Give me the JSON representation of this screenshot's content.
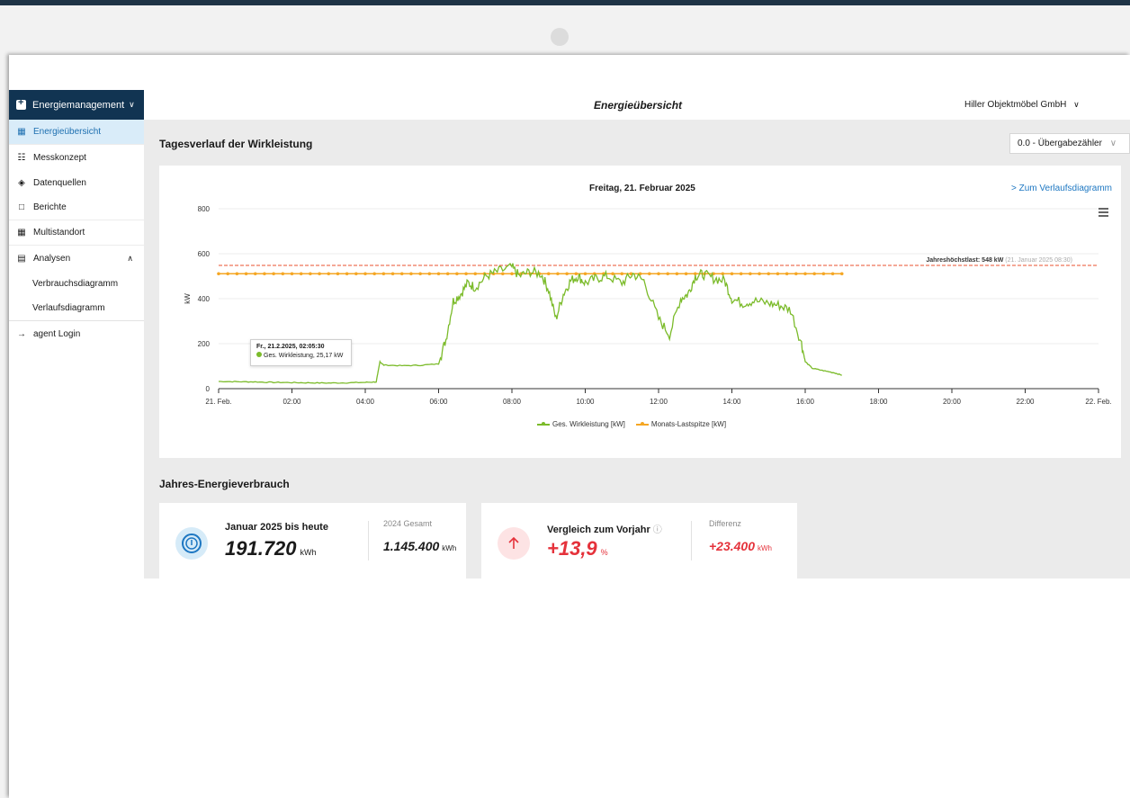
{
  "app": {
    "page_title": "Energieübersicht",
    "company": "Hiller Objektmöbel GmbH"
  },
  "sidebar": {
    "header": "Energiemanagement",
    "items": [
      {
        "label": "Energieübersicht",
        "icon": "dashboard-icon",
        "active": true
      },
      {
        "label": "Messkonzept",
        "icon": "hierarchy-icon"
      },
      {
        "label": "Datenquellen",
        "icon": "datasource-icon"
      },
      {
        "label": "Berichte",
        "icon": "document-icon"
      },
      {
        "label": "Multistandort",
        "icon": "buildings-icon"
      },
      {
        "label": "Analysen",
        "icon": "chart-icon"
      },
      {
        "label": "Verbrauchsdiagramm",
        "icon": ""
      },
      {
        "label": "Verlaufsdiagramm",
        "icon": ""
      },
      {
        "label": "agent Login",
        "icon": "arrow-right-icon"
      }
    ]
  },
  "main": {
    "section1_title": "Tagesverlauf der Wirkleistung",
    "meter_select": "0.0 - Übergabezähler",
    "chart_link": "Zum Verlaufsdiagramm",
    "tooltip": {
      "title": "Fr., 21.2.2025, 02:05:30",
      "line": "Ges. Wirkleistung, 25,17 kW"
    },
    "annotation": {
      "label": "Jahreshöchstlast: 548 kW",
      "detail": "(21. Januar 2025 08:30)"
    },
    "section2_title": "Jahres-Energieverbrauch",
    "card1": {
      "label": "Januar 2025 bis heute",
      "value": "191.720",
      "unit": "kWh",
      "sub_label": "2024 Gesamt",
      "sub_value": "1.145.400",
      "sub_unit": "kWh"
    },
    "card2": {
      "label": "Vergleich zum Vorjahr",
      "value": "+13,9",
      "unit": "%",
      "sub_label": "Differenz",
      "sub_value": "+23.400",
      "sub_unit": "kWh"
    }
  },
  "colors": {
    "primary_dark": "#113452",
    "accent_blue": "#1d77c2",
    "series_green": "#7bbb2a",
    "series_orange": "#f5a623",
    "annual_peak_red": "#e8502f",
    "negative_red": "#e5323b"
  },
  "chart_data": {
    "type": "line",
    "title": "Freitag, 21. Februar 2025",
    "ylabel": "kW",
    "ylim": [
      0,
      800
    ],
    "yticks": [
      0,
      200,
      400,
      600,
      800
    ],
    "xticks": [
      "21. Feb.",
      "02:00",
      "04:00",
      "06:00",
      "08:00",
      "10:00",
      "12:00",
      "14:00",
      "16:00",
      "18:00",
      "20:00",
      "22:00",
      "22. Feb."
    ],
    "xlim_hours": [
      0,
      24
    ],
    "series": [
      {
        "name": "Ges. Wirkleistung [kW]",
        "x_hours": [
          0,
          0.5,
          1,
          1.5,
          2,
          2.5,
          3,
          3.5,
          4,
          4.3,
          4.4,
          4.5,
          5,
          5.5,
          6,
          6.2,
          6.4,
          6.6,
          6.8,
          7,
          7.3,
          7.6,
          8,
          8.2,
          8.5,
          8.8,
          9,
          9.2,
          9.4,
          9.6,
          9.8,
          10,
          10.3,
          10.6,
          11,
          11.3,
          11.6,
          12,
          12.3,
          12.6,
          12.8,
          13,
          13.2,
          13.5,
          13.8,
          14,
          14.3,
          14.6,
          15,
          15.3,
          15.6,
          15.9,
          16,
          16.2,
          16.5,
          16.8,
          17
        ],
        "values": [
          32,
          31,
          30,
          28,
          27,
          26,
          25,
          26,
          28,
          30,
          120,
          105,
          102,
          104,
          110,
          220,
          390,
          420,
          470,
          450,
          500,
          520,
          540,
          500,
          520,
          510,
          440,
          310,
          420,
          480,
          500,
          470,
          490,
          500,
          470,
          510,
          480,
          310,
          240,
          400,
          420,
          500,
          510,
          490,
          480,
          400,
          380,
          390,
          380,
          370,
          350,
          200,
          120,
          90,
          80,
          70,
          60
        ]
      },
      {
        "name": "Monats-Lastspitze [kW]",
        "x_hours": [
          0,
          17
        ],
        "values": [
          511,
          511
        ]
      }
    ],
    "reference_line": {
      "label": "Jahreshöchstlast: 548 kW",
      "value": 548
    },
    "legend": "bottom-center"
  }
}
